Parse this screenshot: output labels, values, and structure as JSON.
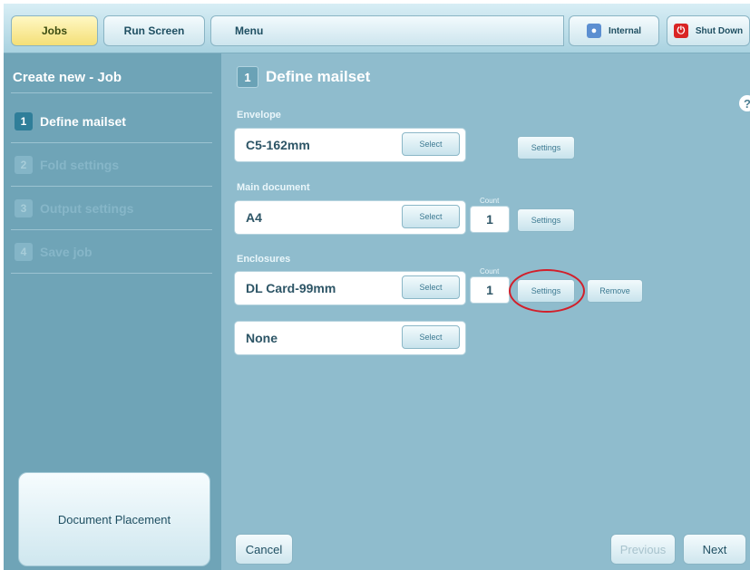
{
  "topbar": {
    "jobs": "Jobs",
    "run_screen": "Run Screen",
    "menu": "Menu",
    "internal": "Internal",
    "shut_down": "Shut Down"
  },
  "sidebar": {
    "title": "Create new - Job",
    "steps": [
      {
        "num": "1",
        "label": "Define mailset"
      },
      {
        "num": "2",
        "label": "Fold settings"
      },
      {
        "num": "3",
        "label": "Output settings"
      },
      {
        "num": "4",
        "label": "Save job"
      }
    ],
    "document_placement": "Document Placement"
  },
  "main": {
    "step_num": "1",
    "title": "Define mailset",
    "help": "?",
    "envelope": {
      "label": "Envelope",
      "value": "C5-162mm",
      "select": "Select",
      "settings": "Settings"
    },
    "main_document": {
      "label": "Main document",
      "value": "A4",
      "select": "Select",
      "count_label": "Count",
      "count": "1",
      "settings": "Settings"
    },
    "enclosures": {
      "label": "Enclosures",
      "items": [
        {
          "value": "DL Card-99mm",
          "select": "Select",
          "count_label": "Count",
          "count": "1",
          "settings": "Settings",
          "remove": "Remove"
        },
        {
          "value": "None",
          "select": "Select"
        }
      ]
    },
    "cancel": "Cancel",
    "previous": "Previous",
    "next": "Next"
  },
  "colors": {
    "accent": "#2f7e99",
    "highlight_circle": "#d21f2a",
    "active_tab": "#f4df77"
  }
}
